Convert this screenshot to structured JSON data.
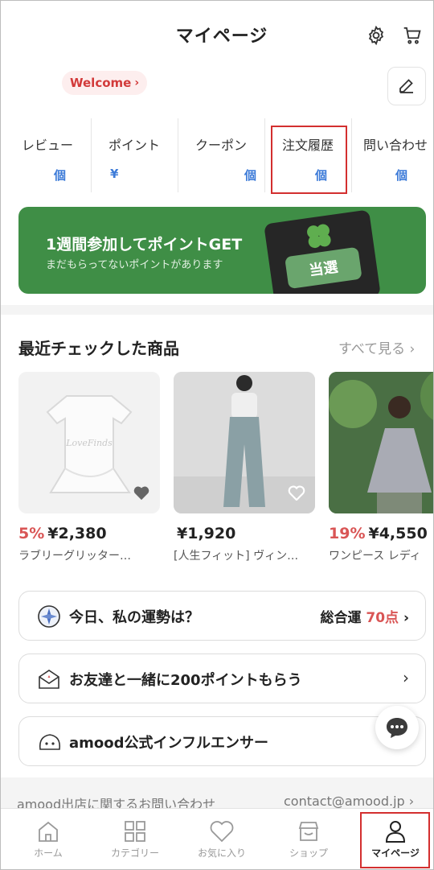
{
  "header": {
    "title": "マイページ",
    "settings_icon": "gear-icon",
    "cart_icon": "cart-icon"
  },
  "profile": {
    "welcome_label": "Welcome",
    "edit_icon": "edit-icon"
  },
  "stats": [
    {
      "label": "レビュー",
      "value": "個"
    },
    {
      "label": "ポイント",
      "value": "¥"
    },
    {
      "label": "クーポン",
      "value": "個"
    },
    {
      "label": "注文履歴",
      "value": "個"
    },
    {
      "label": "問い合わせ",
      "value": "個"
    }
  ],
  "banner": {
    "title": "1週間参加してポイントGET",
    "subtitle": "まだもらってないポイントがあります",
    "ticket_text": "当選",
    "bg_color": "#3f8e46"
  },
  "recent": {
    "title": "最近チェックした商品",
    "see_all": "すべて見る",
    "products": [
      {
        "discount": "5%",
        "price": "¥2,380",
        "name": "ラブリーグリッター…"
      },
      {
        "discount": "",
        "price": "¥1,920",
        "name": "[人生フィット] ヴィン…"
      },
      {
        "discount": "19%",
        "price": "¥4,550",
        "name": "ワンピース レディ"
      }
    ]
  },
  "cards": {
    "fortune": {
      "label": "今日、私の運勢は？",
      "right_prefix": "総合運",
      "score": "70点"
    },
    "invite": {
      "label": "お友達と一緒に200ポイントもらう"
    },
    "influencer": {
      "label": "amood公式インフルエンサー"
    }
  },
  "footer": {
    "inquiry": "amood出店に関するお問い合わせ",
    "contact": "contact@amood.jp"
  },
  "nav": [
    {
      "label": "ホーム",
      "icon": "home-icon"
    },
    {
      "label": "カテゴリー",
      "icon": "category-grid-icon"
    },
    {
      "label": "お気に入り",
      "icon": "heart-icon"
    },
    {
      "label": "ショップ",
      "icon": "shop-icon"
    },
    {
      "label": "マイページ",
      "icon": "person-icon"
    }
  ],
  "colors": {
    "accent_blue": "#3d7bd8",
    "discount_red": "#d95555",
    "highlight_red": "#d32f2f"
  }
}
